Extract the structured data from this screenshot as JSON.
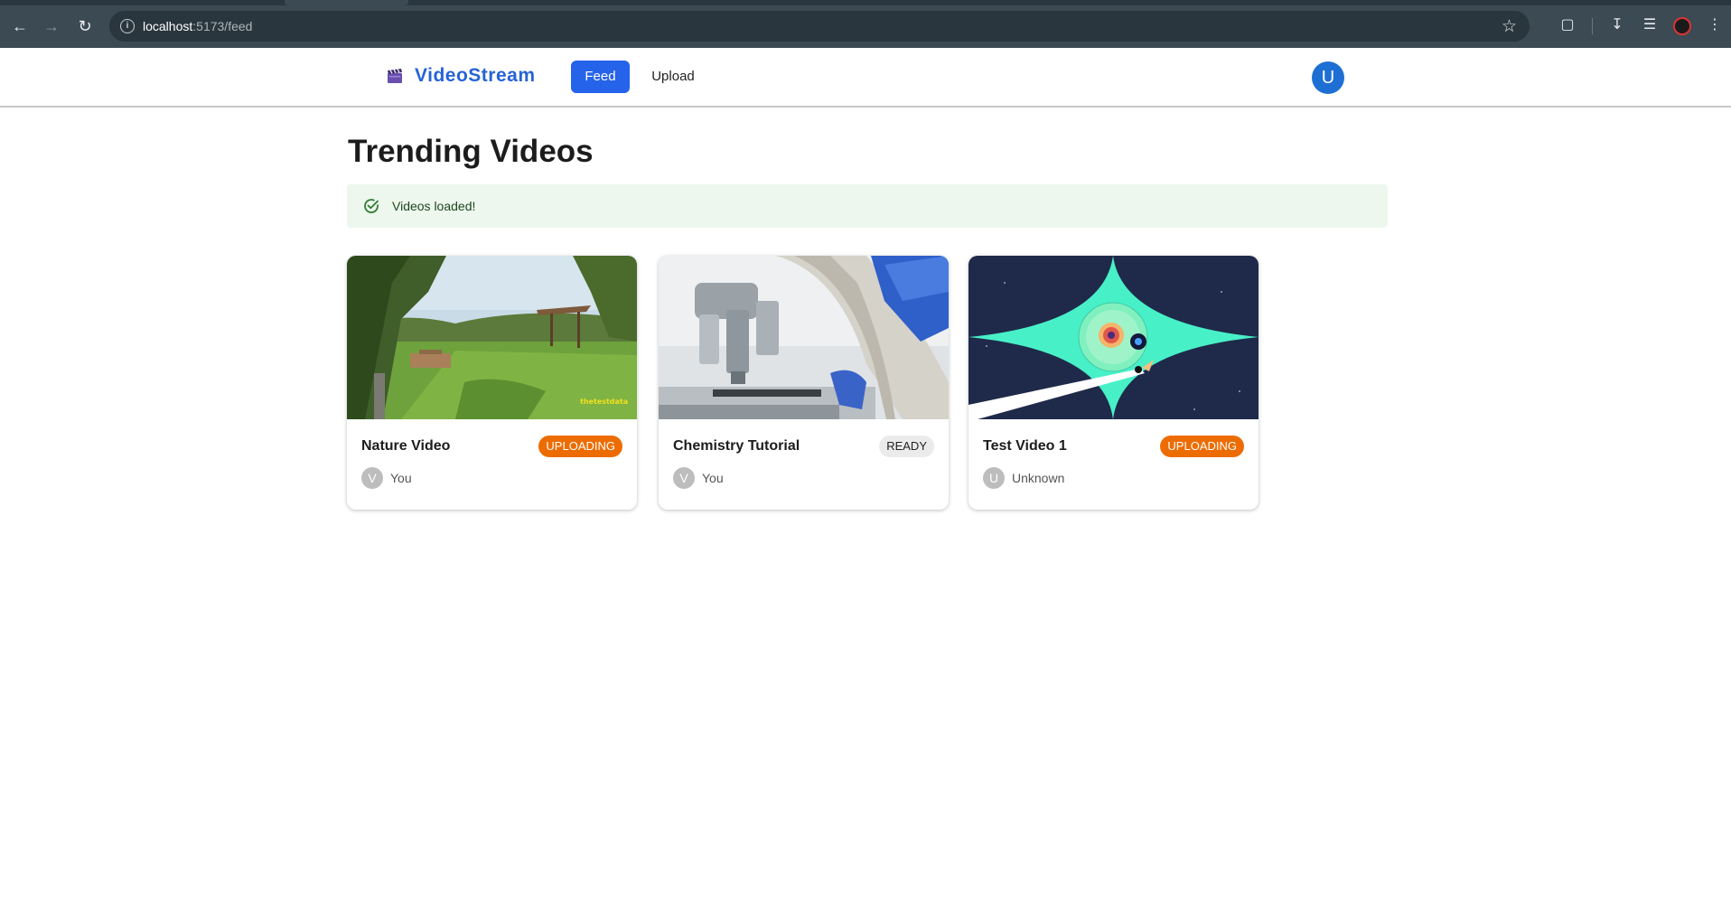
{
  "browser": {
    "url_host": "localhost",
    "url_path": ":5173/feed"
  },
  "header": {
    "logo_text": "VideoStream",
    "nav": {
      "feed": "Feed",
      "upload": "Upload"
    },
    "user_initial": "U",
    "colors": {
      "brand": "#2663d6",
      "active_nav": "#2563eb",
      "avatar": "#1e6fd4"
    }
  },
  "main": {
    "title": "Trending Videos",
    "alert": {
      "message": "Videos loaded!",
      "color": "#edf7ed"
    },
    "videos": [
      {
        "title": "Nature Video",
        "status": "UPLOADING",
        "owner_initial": "V",
        "owner": "You",
        "thumb_watermark": "thetestdata"
      },
      {
        "title": "Chemistry Tutorial",
        "status": "READY",
        "owner_initial": "V",
        "owner": "You"
      },
      {
        "title": "Test Video 1",
        "status": "UPLOADING",
        "owner_initial": "U",
        "owner": "Unknown"
      }
    ]
  }
}
